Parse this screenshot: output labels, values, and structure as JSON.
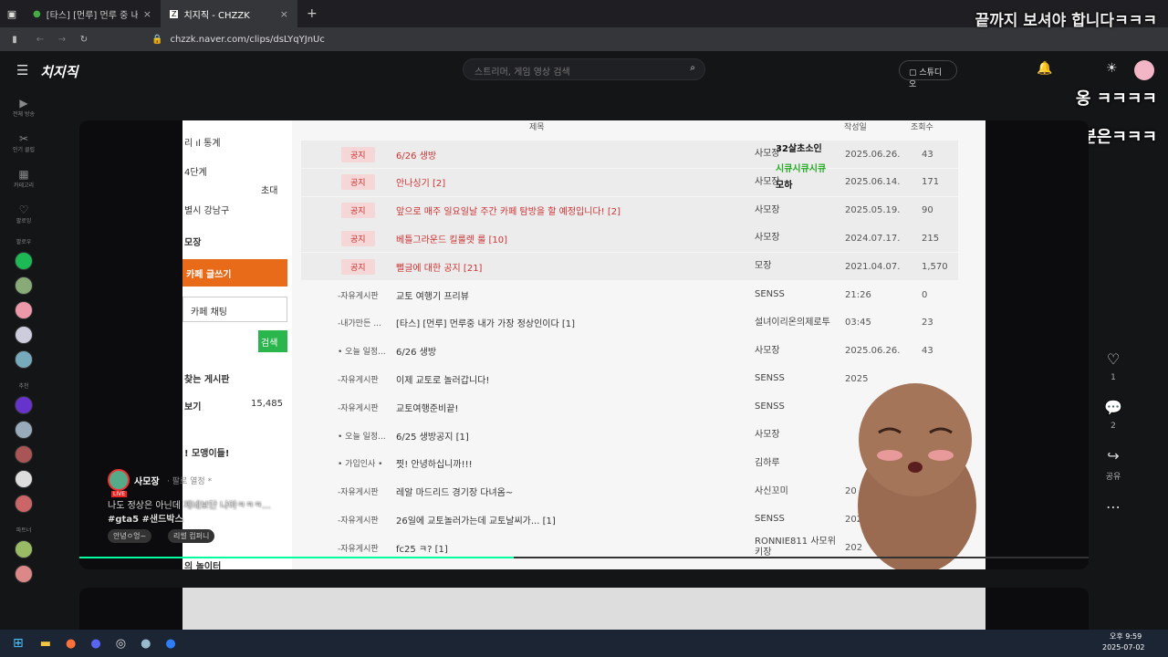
{
  "browser": {
    "tabs": [
      {
        "title": "[타스] [먼루] 먼루 중 내가 가장...",
        "active": false
      },
      {
        "title": "치지직 - CHZZK",
        "active": true
      }
    ],
    "url": "chzzk.naver.com/clips/dsLYqYJnUc"
  },
  "header": {
    "logo": "치지직",
    "search_placeholder": "스트리머, 게임 영상 검색",
    "studio_label": "스튜디오"
  },
  "sidebar": {
    "items": [
      "전체 방송",
      "인기 클립",
      "카테고리",
      "팔로잉"
    ],
    "section_follow": "팔로우",
    "section_recommend": "추천",
    "section_partner": "파트너"
  },
  "overlay": {
    "top": "끝까지 보셔야 합니다ㅋㅋㅋ",
    "line1": "옹 ㅋㅋㅋㅋ",
    "line2": "이분은ㅋㅋㅋ",
    "char_tag1": "32살초소인",
    "char_tag2": "시큐시큐시큐",
    "char_tag3": "모하"
  },
  "cafe": {
    "header": {
      "title": "제목",
      "date": "작성일",
      "views": "조회수"
    },
    "left": {
      "stats": "리 ıl 통계",
      "level": "4단계",
      "invite": "초대",
      "region": "별시 강남구",
      "manager": "모장",
      "write": "카페 글쓰기",
      "chat": "카페 채팅",
      "search_btn": "검색",
      "boards": "찾는 게시판",
      "view_all": "보기",
      "view_count": "15,485",
      "greeting": "! 모앵이들!",
      "last": "의 놀이터"
    },
    "rows": [
      {
        "tag": "공지",
        "title": "6/26 생방",
        "author": "사모장",
        "date": "2025.06.26.",
        "views": "43"
      },
      {
        "tag": "공지",
        "title": "안나싱기 [2]",
        "author": "사모장",
        "date": "2025.06.14.",
        "views": "171"
      },
      {
        "tag": "공지",
        "title": "앞으로 매주 일요일날 주간 카페 탐방을 할 예정입니다! [2]",
        "author": "사모장",
        "date": "2025.05.19.",
        "views": "90"
      },
      {
        "tag": "공지",
        "title": "베틀그라운드 킬룰렛 룰 [10]",
        "author": "사모장",
        "date": "2024.07.17.",
        "views": "215"
      },
      {
        "tag": "공지",
        "title": "뻘글에 대한 공지 [21]",
        "author": "모장",
        "date": "2021.04.07.",
        "views": "1,570"
      },
      {
        "tag": "-자유게시판",
        "title": "교토 여행기 프리뷰",
        "author": "SENSS",
        "date": "21:26",
        "views": "0"
      },
      {
        "tag": "-내가만든 ...",
        "title": "[타스] [먼루] 먼루중 내가 가장 정상인이다 [1]",
        "author": "설녀이리온의제로투",
        "date": "03:45",
        "views": "23"
      },
      {
        "tag": "• 오늘 일정...",
        "title": "6/26 생방",
        "author": "사모장",
        "date": "2025.06.26.",
        "views": "43"
      },
      {
        "tag": "-자유게시판",
        "title": "이제 교토로 놀러갑니다!",
        "author": "SENSS",
        "date": "2025",
        "views": ""
      },
      {
        "tag": "-자유게시판",
        "title": "교토여행준비끝!",
        "author": "SENSS",
        "date": "",
        "views": ""
      },
      {
        "tag": "• 오늘 일정...",
        "title": "6/25 생방공지 [1]",
        "author": "사모장",
        "date": "",
        "views": ""
      },
      {
        "tag": "• 가입인사 •",
        "title": "찟! 안녕하십니까!!!",
        "author": "김하루",
        "date": "",
        "views": ""
      },
      {
        "tag": "-자유게시판",
        "title": "레알 마드리드 경기장 다녀옴~",
        "author": "사신꼬미",
        "date": "20",
        "views": ""
      },
      {
        "tag": "-자유게시판",
        "title": "26일에 교토놀러가는데 교토날씨가... [1]",
        "author": "SENSS",
        "date": "2025.0",
        "views": ""
      },
      {
        "tag": "-자유게시판",
        "title": "fc25 ㅋ? [1]",
        "author": "RONNIE811 사모위키장",
        "date": "202",
        "views": ""
      }
    ]
  },
  "clip": {
    "channel": "사모장",
    "channel_extra": "· 팔로 열정 *",
    "live": "LIVE",
    "title": "나도 정상은 아닌데 제네보단 나아ㅋㅋㅋ...",
    "hashtags": "#gta5 #샌드박스",
    "tag1": "안녕ㅇ엉~",
    "tag2": "리썰 컴퍼니"
  },
  "actions": {
    "like": "1",
    "comment": "2",
    "share": "공유"
  },
  "taskbar": {
    "time": "오후 9:59",
    "date": "2025-07-02"
  }
}
